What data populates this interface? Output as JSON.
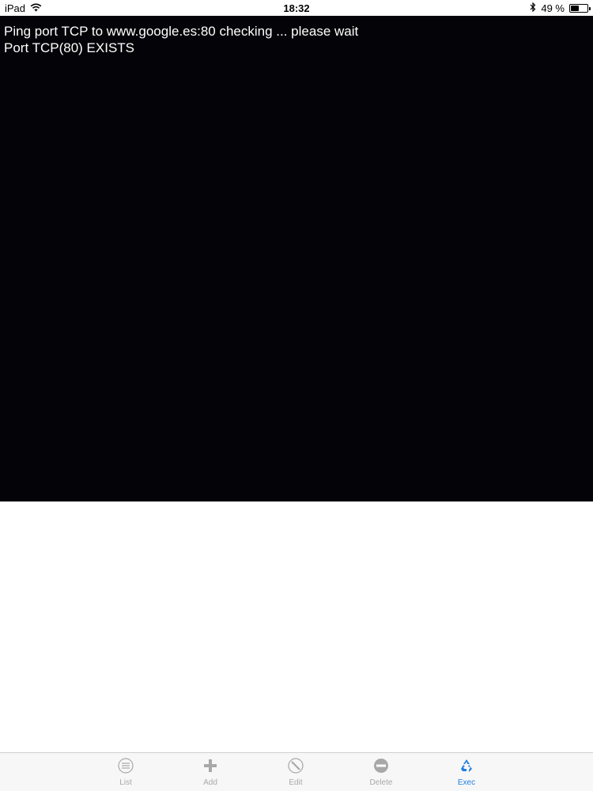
{
  "status_bar": {
    "device": "iPad",
    "time": "18:32",
    "battery_text": "49 %",
    "battery_level": 0.49,
    "wifi_icon": "wifi-icon",
    "bluetooth_icon": "bluetooth-icon"
  },
  "console": {
    "lines": [
      "Ping port TCP to www.google.es:80 checking ... please wait",
      "Port TCP(80) EXISTS"
    ],
    "background": "#040307",
    "text_color": "#ffffff"
  },
  "tab_bar": {
    "items": [
      {
        "label": "List",
        "icon": "list-icon",
        "active": false
      },
      {
        "label": "Add",
        "icon": "plus-icon",
        "active": false
      },
      {
        "label": "Edit",
        "icon": "edit-icon",
        "active": false
      },
      {
        "label": "Delete",
        "icon": "minus-icon",
        "active": false
      },
      {
        "label": "Exec",
        "icon": "recycle-icon",
        "active": true
      }
    ],
    "active_color": "#1f7fe0",
    "inactive_color": "#a8a8a8"
  }
}
